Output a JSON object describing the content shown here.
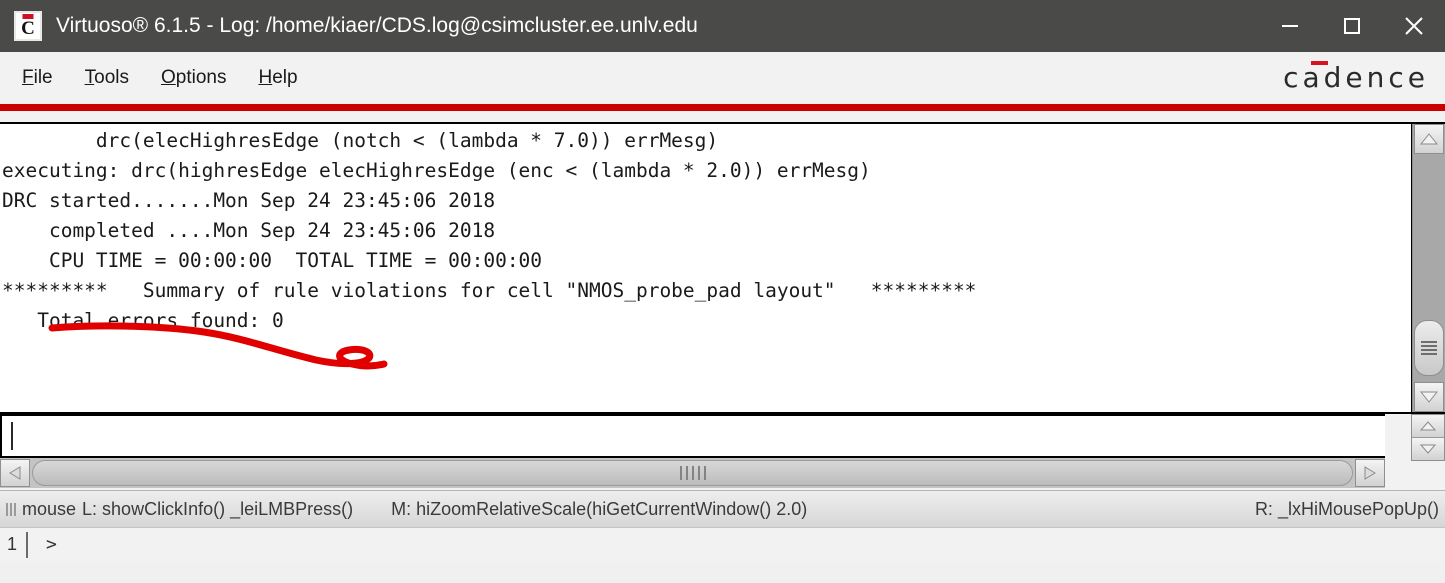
{
  "window": {
    "title": "Virtuoso® 6.1.5 - Log: /home/kiaer/CDS.log@csimcluster.ee.unlv.edu",
    "icon_letter": "C",
    "minimize_label": "Minimize",
    "maximize_label": "Maximize",
    "close_label": "Close",
    "titlebar_color": "#4a4a48"
  },
  "menubar": {
    "items": [
      {
        "label": "File",
        "mnemonic": "F",
        "rest": "ile"
      },
      {
        "label": "Tools",
        "mnemonic": "T",
        "rest": "ools"
      },
      {
        "label": "Options",
        "mnemonic": "O",
        "rest": "ptions"
      },
      {
        "label": "Help",
        "mnemonic": "H",
        "rest": "elp"
      }
    ],
    "brand": "cadence",
    "brand_accent_color": "#d9121f",
    "rule_color": "#cc0000"
  },
  "log": {
    "lines": [
      "        drc(elecHighresEdge (notch < (lambda * 7.0)) errMesg)",
      "executing: drc(highresEdge elecHighresEdge (enc < (lambda * 2.0)) errMesg)",
      "DRC started.......Mon Sep 24 23:45:06 2018",
      "    completed ....Mon Sep 24 23:45:06 2018",
      "    CPU TIME = 00:00:00  TOTAL TIME = 00:00:00",
      "*********   Summary of rule violations for cell \"NMOS_probe_pad layout\"   *********",
      "   Total errors found: 0"
    ],
    "annotation_color": "#e00000",
    "annotation_description": "hand-drawn red underline with hook under Total errors found: 0"
  },
  "command_input": {
    "value": "",
    "placeholder": ""
  },
  "statusbar": {
    "mouse_prefix": "mouse",
    "left": "L: showClickInfo() _leiLMBPress()",
    "middle": "M: hiZoomRelativeScale(hiGetCurrentWindow() 2.0)",
    "right": "R: _lxHiMousePopUp()"
  },
  "prompt": {
    "number": "1",
    "symbol": ">"
  }
}
